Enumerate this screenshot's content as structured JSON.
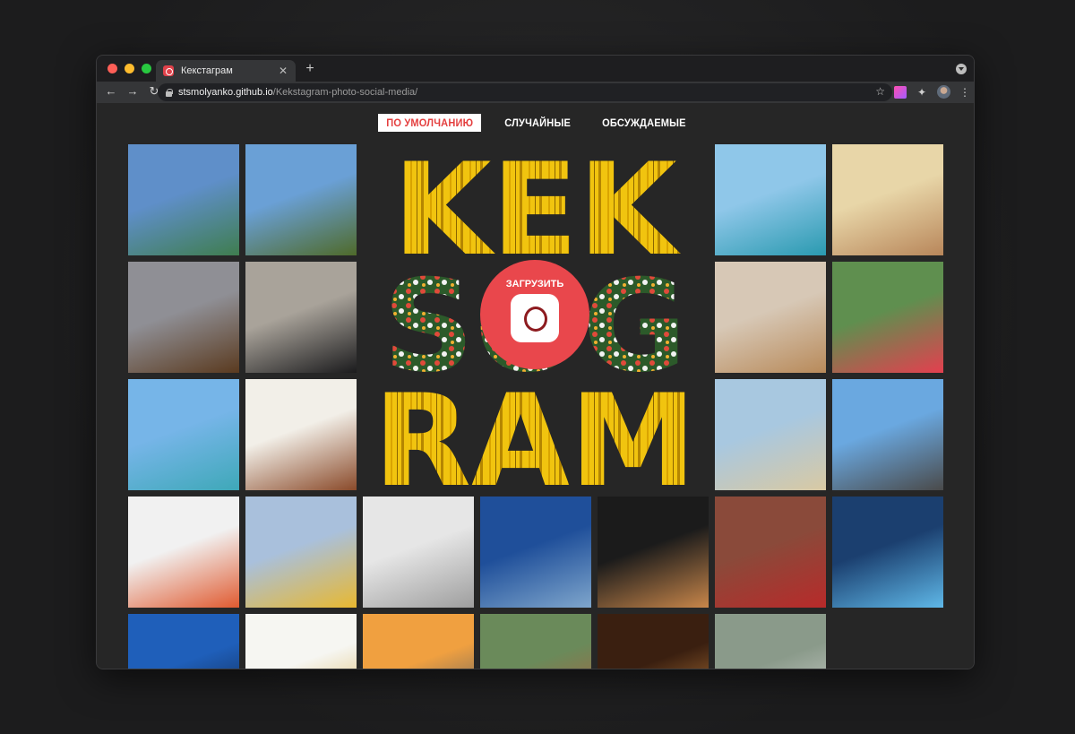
{
  "browser": {
    "tab_title": "Кекстаграм",
    "url_host": "stsmolyanko.github.io",
    "url_path": "/Kekstagram-photo-social-media/",
    "new_tab_symbol": "+",
    "tab_close_symbol": "✕"
  },
  "filters": [
    {
      "label": "ПО УМОЛЧАНИЮ",
      "active": true
    },
    {
      "label": "СЛУЧАЙНЫЕ",
      "active": false
    },
    {
      "label": "ОБСУЖДАЕМЫЕ",
      "active": false
    }
  ],
  "logo": {
    "lines": [
      "KEK",
      "SOG",
      "RAM"
    ],
    "upload_label": "ЗАГРУЗИТЬ"
  },
  "colors": {
    "accent_red": "#e9474c",
    "logo_yellow": "#f1c40f",
    "page_bg": "#262626"
  },
  "photos": [
    {
      "id": 1,
      "subject": "coastal-resort",
      "c1": "#5f8fc9",
      "c2": "#3f7d4f"
    },
    {
      "id": 2,
      "subject": "beach-sign",
      "c1": "#6aa0d6",
      "c2": "#4f6a2a"
    },
    {
      "id": 3,
      "subject": "tropical-lagoon",
      "c1": "#8fc7e9",
      "c2": "#2a9ab0"
    },
    {
      "id": 4,
      "subject": "woman-beach-camera",
      "c1": "#e8d6a8",
      "c2": "#b8865a"
    },
    {
      "id": 5,
      "subject": "snowman-soup",
      "c1": "#8f8f95",
      "c2": "#5a3a1f"
    },
    {
      "id": 6,
      "subject": "black-supercar",
      "c1": "#a9a39a",
      "c2": "#1b1b1d"
    },
    {
      "id": 7,
      "subject": "strawberries-plate",
      "c1": "#d7c8b6",
      "c2": "#b88a5a"
    },
    {
      "id": 8,
      "subject": "red-drink",
      "c1": "#5f8f4f",
      "c2": "#e43f4f"
    },
    {
      "id": 9,
      "subject": "plane-beach",
      "c1": "#76b5e8",
      "c2": "#3ea8b8"
    },
    {
      "id": 10,
      "subject": "sandal-shelf",
      "c1": "#f2efe8",
      "c2": "#8a4a2a"
    },
    {
      "id": 11,
      "subject": "dune-path",
      "c1": "#a8c8e0",
      "c2": "#d9c9a3"
    },
    {
      "id": 12,
      "subject": "white-audi",
      "c1": "#6aa8e0",
      "c2": "#4a4a4a"
    },
    {
      "id": 13,
      "subject": "seafood-plate",
      "c1": "#f1f1f1",
      "c2": "#e05a30"
    },
    {
      "id": 14,
      "subject": "sushi-cat",
      "c1": "#a9c0dc",
      "c2": "#e8b830"
    },
    {
      "id": 15,
      "subject": "robot-slippers",
      "c1": "#e6e6e6",
      "c2": "#9e9e9e"
    },
    {
      "id": 16,
      "subject": "sky-from-plane",
      "c1": "#1f4f9a",
      "c2": "#7fa6cc"
    },
    {
      "id": 17,
      "subject": "choir-stage",
      "c1": "#1b1b1b",
      "c2": "#c8864a"
    },
    {
      "id": 18,
      "subject": "red-lowrider",
      "c1": "#8a4a3a",
      "c2": "#b82a2a"
    },
    {
      "id": 19,
      "subject": "glowing-slippers",
      "c1": "#1b3f6f",
      "c2": "#5fb8e8"
    },
    {
      "id": 20,
      "subject": "palm-trees",
      "c1": "#1f5fba",
      "c2": "#0f1f3a"
    },
    {
      "id": 21,
      "subject": "noodle-bowl",
      "c1": "#f6f6f2",
      "c2": "#d8b050"
    },
    {
      "id": 22,
      "subject": "sunset-sea",
      "c1": "#f0a040",
      "c2": "#3a4f6a"
    },
    {
      "id": 23,
      "subject": "crab",
      "c1": "#6a8a5a",
      "c2": "#b85a3a"
    },
    {
      "id": 24,
      "subject": "candle-hands",
      "c1": "#3a1f10",
      "c2": "#d08a40"
    },
    {
      "id": 25,
      "subject": "jeep-road",
      "c1": "#8a9a8a",
      "c2": "#d8d8d8"
    }
  ]
}
